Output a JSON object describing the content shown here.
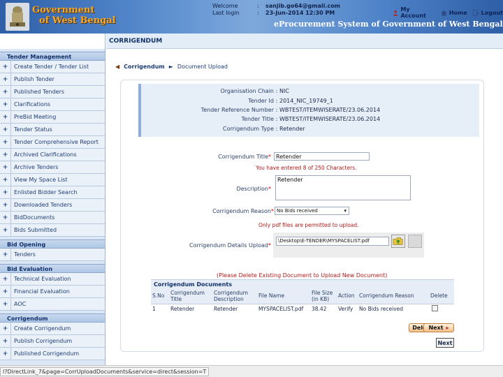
{
  "header": {
    "brand_line1": "Government",
    "brand_line2": "of West Bengal",
    "welcome_label": "Welcome",
    "welcome_value": "sanjib.go64@gmail.com",
    "last_login_label": "Last login",
    "last_login_value": "23-Jun-2014 12:30 PM",
    "links": {
      "my_account": "My Account",
      "home": "Home",
      "logout": "Logout"
    },
    "system_title": "eProcurement System of Government of West Bengal"
  },
  "sidebar": {
    "sections": [
      {
        "title": "Tender Management",
        "items": [
          "Create Tender / Tender List",
          "Publish Tender",
          "Published Tenders",
          "Clarifications",
          "PreBid Meeting",
          "Tender Status",
          "Tender Comprehensive Report",
          "Archived Clarifications",
          "Archive Tenders",
          "View My Space List",
          "Enlisted Bidder Search",
          "Downloaded Tenders",
          "BidDocuments",
          "Bids Submitted"
        ]
      },
      {
        "title": "Bid Opening",
        "items": [
          "Tenders"
        ]
      },
      {
        "title": "Bid Evaluation",
        "items": [
          "Technical Evaluation",
          "Financial Evaluation",
          "AOC"
        ]
      },
      {
        "title": "Corrigendum",
        "items": [
          "Create Corrigendum",
          "Publish Corrigendum",
          "Published Corrigendum"
        ]
      }
    ]
  },
  "page": {
    "section_title": "CORRIGENDUM",
    "breadcrumb": {
      "parent": "Corrigendum",
      "current": "Document Upload"
    }
  },
  "info": [
    {
      "label": "Organisation Chain",
      "value": "NIC"
    },
    {
      "label": "Tender Id",
      "value": "2014_NIC_19749_1"
    },
    {
      "label": "Tender Reference Number",
      "value": "WBTEST/ITEMWISERATE/23.06.2014"
    },
    {
      "label": "Tender Title",
      "value": "WBTEST/ITEMWISERATE/23.06.2014"
    },
    {
      "label": "Corrigendum Type",
      "value": "Retender"
    }
  ],
  "form": {
    "title_label": "Corrigendum Title",
    "title_value": "Retender",
    "char_hint": "You have entered 8 of 250 Characters.",
    "description_label": "Description",
    "description_value": "Retender",
    "reason_label": "Corrigendum Reason",
    "reason_value": "No Bids received",
    "pdf_hint": "Only pdf files are permitted to upload.",
    "upload_label": "Corrigendum Details Upload",
    "upload_value": "\\Desktop\\E-TENDER\\MYSPACELIST.pdf"
  },
  "documents": {
    "warning": "(Please Delete Existing Document to Upload New Document)",
    "title": "Corrigendum Documents",
    "columns": [
      "S.No",
      "Corrigendum Title",
      "Corrigendum Description",
      "File Name",
      "File Size (in KB)",
      "Action",
      "Corrigendum Reason",
      "Delete"
    ],
    "rows": [
      [
        "1",
        "Retender",
        "Retender",
        "MYSPACELIST.pdf",
        "38.42",
        "Verify",
        "No Bids received",
        ""
      ]
    ]
  },
  "buttons": {
    "delete": "Delete",
    "next": "Next",
    "next_plain": "Next"
  },
  "status_bar": "l?DirectLink_7&page=CorrUploadDocuments&service=direct&session=T"
}
